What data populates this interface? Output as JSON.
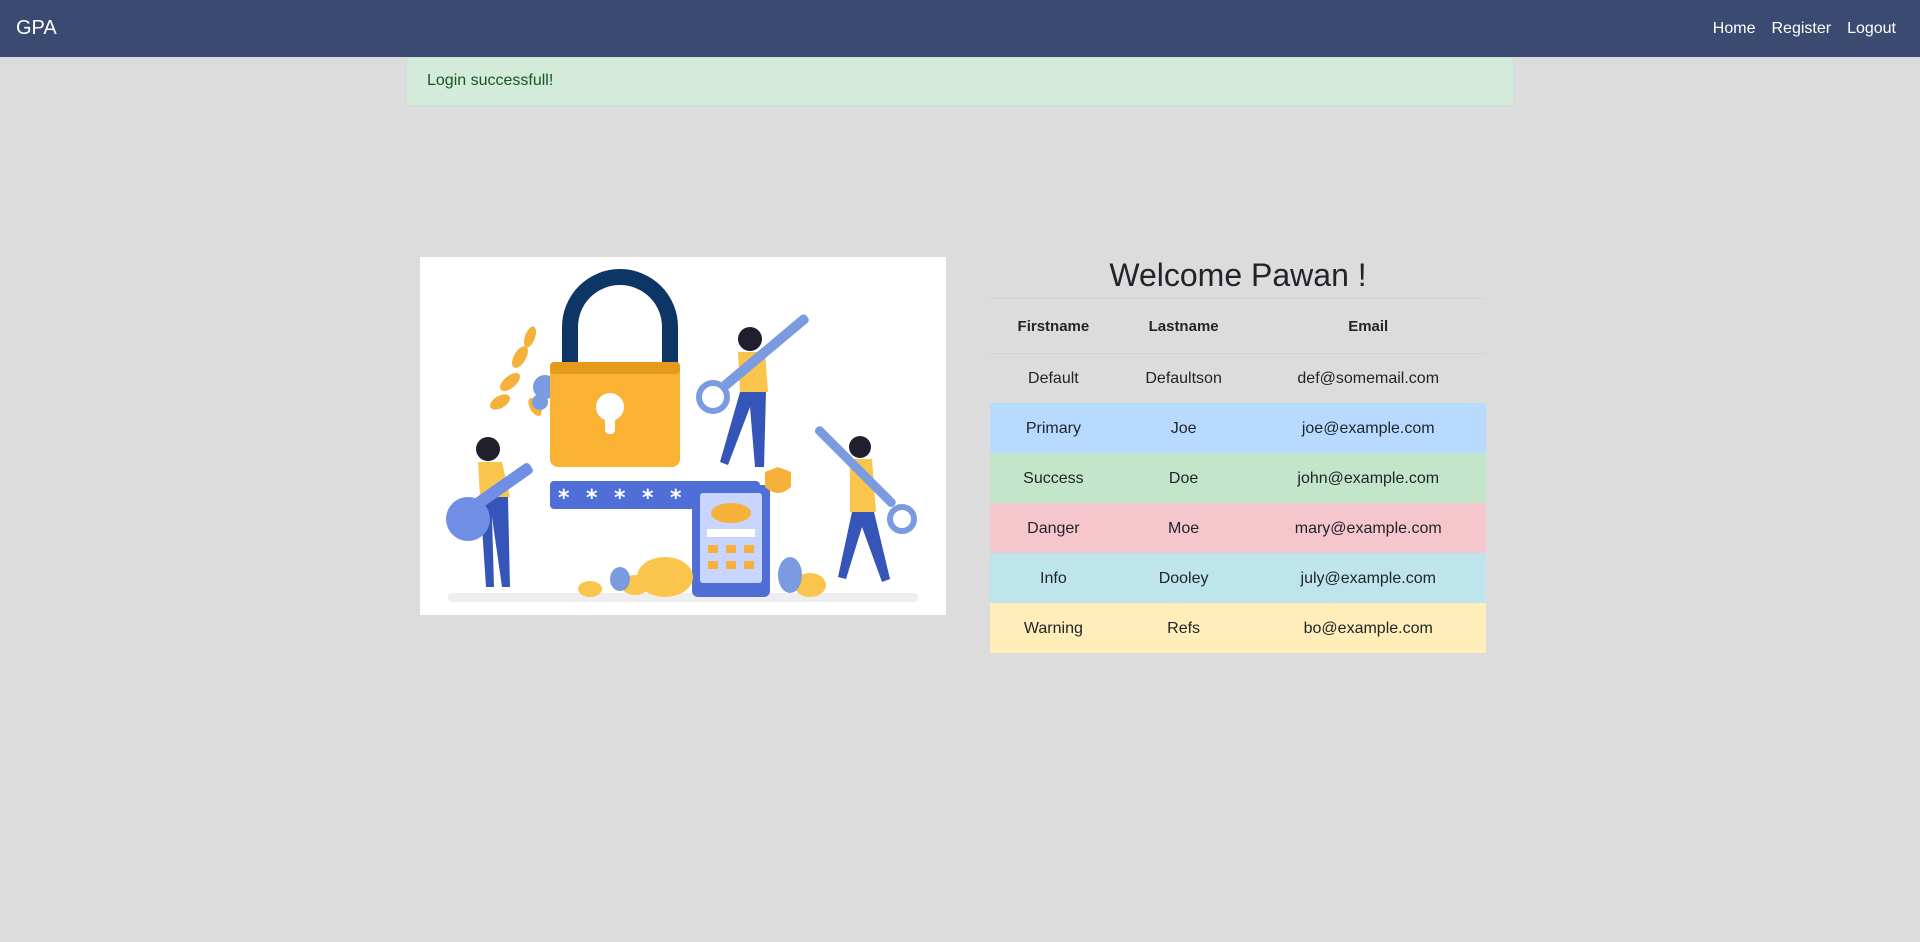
{
  "navbar": {
    "brand": "GPA",
    "links": [
      {
        "label": "Home"
      },
      {
        "label": "Register"
      },
      {
        "label": "Logout"
      }
    ],
    "background": "#3b4a70"
  },
  "alert": {
    "message": "Login successfull!",
    "type": "success"
  },
  "illustration": {
    "icon": "login-security-illustration"
  },
  "welcome": {
    "title": "Welcome Pawan !"
  },
  "table": {
    "headers": [
      "Firstname",
      "Lastname",
      "Email"
    ],
    "rows": [
      {
        "firstname": "Default",
        "lastname": "Defaultson",
        "email": "def@somemail.com",
        "variant": "default"
      },
      {
        "firstname": "Primary",
        "lastname": "Joe",
        "email": "joe@example.com",
        "variant": "primary"
      },
      {
        "firstname": "Success",
        "lastname": "Doe",
        "email": "john@example.com",
        "variant": "success"
      },
      {
        "firstname": "Danger",
        "lastname": "Moe",
        "email": "mary@example.com",
        "variant": "danger"
      },
      {
        "firstname": "Info",
        "lastname": "Dooley",
        "email": "july@example.com",
        "variant": "info"
      },
      {
        "firstname": "Warning",
        "lastname": "Refs",
        "email": "bo@example.com",
        "variant": "warning"
      }
    ]
  }
}
